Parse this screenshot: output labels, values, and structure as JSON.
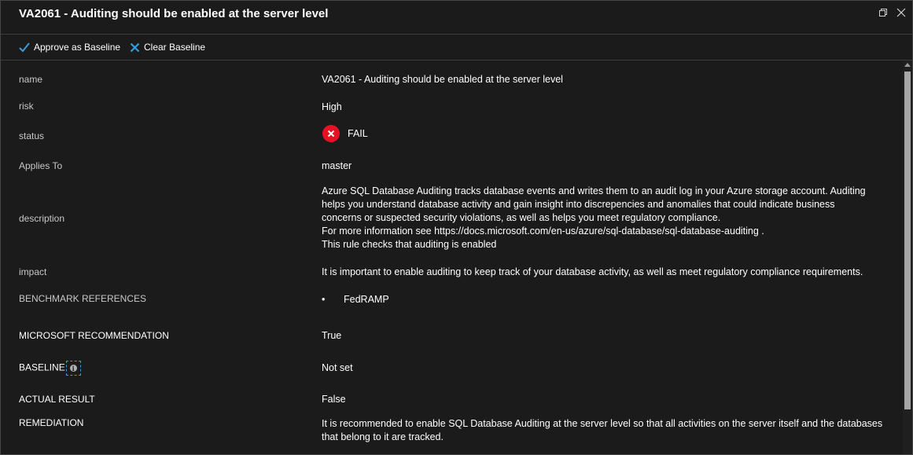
{
  "window": {
    "title": "VA2061 - Auditing should be enabled at the server level",
    "restore_icon": "restore-window-icon",
    "close_icon": "close-icon"
  },
  "toolbar": {
    "approve_label": "Approve as Baseline",
    "clear_label": "Clear Baseline"
  },
  "colors": {
    "background": "#1b1b1b",
    "accent": "#3a9bd5",
    "fail": "#e81123"
  },
  "details": {
    "name_label": "name",
    "name_value": "VA2061 - Auditing should be enabled at the server level",
    "risk_label": "risk",
    "risk_value": "High",
    "status_label": "status",
    "status_value": "FAIL",
    "applies_label": "Applies To",
    "applies_value": "master",
    "description_label": "description",
    "description_lines": [
      "Azure SQL Database Auditing tracks database events and writes them to an audit log in your Azure storage account. Auditing",
      "helps you understand database activity and gain insight into discrepencies and anomalies that could indicate business",
      "concerns or suspected security violations, as well as helps you meet regulatory compliance.",
      " For more information see https://docs.microsoft.com/en-us/azure/sql-database/sql-database-auditing .",
      " This rule checks that auditing is enabled"
    ],
    "impact_label": "impact",
    "impact_value": "It is important to enable auditing to keep track of your database activity, as well as meet regulatory compliance requirements.",
    "benchmark_label": "BENCHMARK REFERENCES",
    "benchmark_items": [
      "FedRAMP"
    ],
    "ms_rec_label": "MICROSOFT RECOMMENDATION",
    "ms_rec_value": "True",
    "baseline_label": "BASELINE",
    "baseline_value": "Not set",
    "actual_label": "ACTUAL RESULT",
    "actual_value": "False",
    "remediation_label": "REMEDIATION",
    "remediation_lines": [
      "It is recommended to enable SQL Database Auditing at the server level so that all activities on the server itself and the databases",
      "that belong to it are tracked."
    ]
  }
}
